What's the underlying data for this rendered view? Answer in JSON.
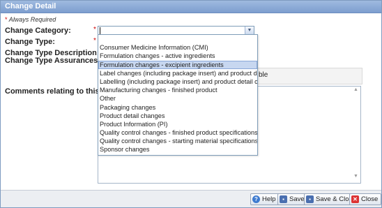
{
  "window": {
    "title": "Change Detail"
  },
  "form": {
    "always_required_star": "*",
    "always_required": "Always Required",
    "change_category_label": "Change Category:",
    "change_type_label": "Change Type:",
    "change_type_description_label": "Change Type Description:",
    "change_type_assurances_label": "Change Type Assurances:",
    "comments_label": "Comments relating to this change:",
    "required_star": "*",
    "assurance_tail": "ble",
    "category_value": ""
  },
  "dropdown": {
    "items": [
      "",
      "Consumer Medicine Information (CMI)",
      "Formulation changes - active ingredients",
      "Formulation changes - excipient ingredients",
      "Label changes (including package insert) and product detail changes",
      "Labelling (including package insert) and product detail changes",
      "Manufacturing changes - finished product",
      "Other",
      "Packaging changes",
      "Product detail changes",
      "Product Information (PI)",
      "Quality control changes - finished product specifications",
      "Quality control changes - starting material specifications",
      "Sponsor changes"
    ],
    "selected_index": 3
  },
  "footer": {
    "help_label": "Help",
    "save_label": "Save",
    "save_close_label": "Save & Close",
    "close_label": "Close"
  },
  "icons": {
    "dropdown_arrow": "chevron-down-icon",
    "help": "help-icon",
    "save": "save-icon",
    "save_close": "save-close-icon",
    "close": "close-icon"
  }
}
